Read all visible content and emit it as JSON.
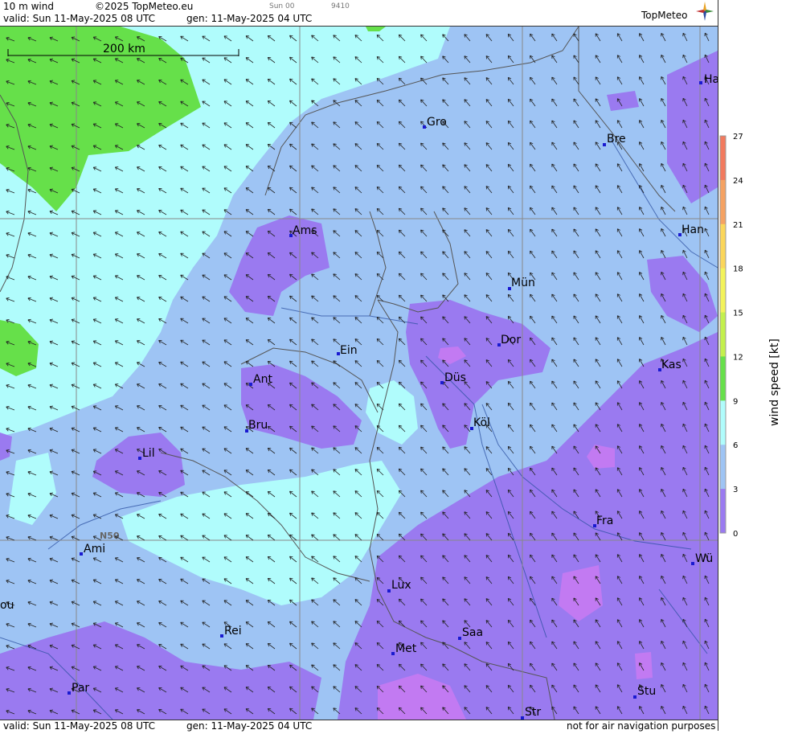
{
  "header": {
    "title": "10 m wind",
    "copyright": "©2025 TopMeteo.eu",
    "small_a": "Sun 00",
    "small_b": "9410",
    "valid": "valid:  Sun  11-May-2025  08 UTC",
    "gen": "gen: 11-May-2025 04 UTC",
    "logo": "TopMeteo"
  },
  "footer": {
    "valid": "valid:  Sun  11-May-2025  08 UTC",
    "gen": "gen: 11-May-2025 04 UTC",
    "note": "not for air navigation purposes"
  },
  "scale_bar": {
    "label": "200 km"
  },
  "grid_label": "N50",
  "cities": [
    {
      "name": "Ha"
    },
    {
      "name": "Gro"
    },
    {
      "name": "Bre"
    },
    {
      "name": "Ams"
    },
    {
      "name": "Han"
    },
    {
      "name": "Mün"
    },
    {
      "name": "Dor"
    },
    {
      "name": "Ein"
    },
    {
      "name": "Kas"
    },
    {
      "name": "Ant"
    },
    {
      "name": "Düs"
    },
    {
      "name": "Köl"
    },
    {
      "name": "Bru"
    },
    {
      "name": "Lil"
    },
    {
      "name": "Fra"
    },
    {
      "name": "Ami"
    },
    {
      "name": "Wü"
    },
    {
      "name": "Lux"
    },
    {
      "name": "ou"
    },
    {
      "name": "Rei"
    },
    {
      "name": "Saa"
    },
    {
      "name": "Met"
    },
    {
      "name": "Par"
    },
    {
      "name": "Stu"
    },
    {
      "name": "Str"
    }
  ],
  "legend": {
    "title": "wind  speed  [kt]",
    "ticks": [
      "27",
      "24",
      "21",
      "18",
      "15",
      "12",
      "9",
      "6",
      "3",
      "0"
    ],
    "colors": [
      "#f27a5e",
      "#f5a262",
      "#fbd65a",
      "#f3f35a",
      "#c3f04d",
      "#66e04a",
      "#b0fcfc",
      "#9ec4f4",
      "#9a7af0",
      "#c27af2"
    ]
  },
  "colors": {
    "cyan": "#b0fcfc",
    "light_blue": "#9ec4f4",
    "purple": "#9a7af0",
    "violet": "#c27af2",
    "green": "#66e04a",
    "city_marker": "#1a1ad0"
  }
}
